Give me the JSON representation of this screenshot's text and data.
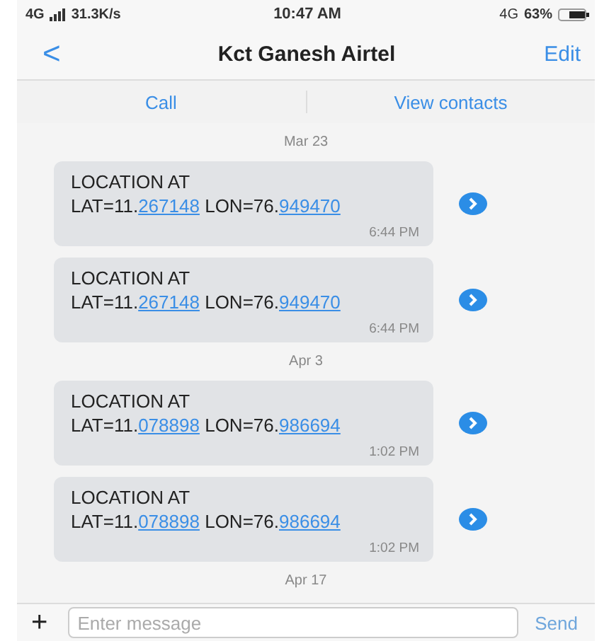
{
  "status_bar": {
    "network": "4G",
    "speed": "31.3K/s",
    "time": "10:47 AM",
    "network_right": "4G",
    "battery": "63%"
  },
  "header": {
    "back": "<",
    "title": "Kct Ganesh Airtel",
    "edit": "Edit"
  },
  "actions": [
    "Call",
    "View contacts"
  ],
  "thread": [
    {
      "kind": "date",
      "text": "Mar 23"
    },
    {
      "kind": "message",
      "heading": "LOCATION AT",
      "lat_prefix": "LAT=11.",
      "lat_link": "267148",
      "lon_prefix": "LON=76.",
      "lon_link": "949470",
      "time": "6:44 PM"
    },
    {
      "kind": "message",
      "heading": "LOCATION AT",
      "lat_prefix": "LAT=11.",
      "lat_link": "267148",
      "lon_prefix": "LON=76.",
      "lon_link": "949470",
      "time": "6:44 PM"
    },
    {
      "kind": "date",
      "text": "Apr 3"
    },
    {
      "kind": "message",
      "heading": "LOCATION AT",
      "lat_prefix": "LAT=11.",
      "lat_link": "078898",
      "lon_prefix": "LON=76.",
      "lon_link": "986694",
      "time": "1:02 PM"
    },
    {
      "kind": "message",
      "heading": "LOCATION AT",
      "lat_prefix": "LAT=11.",
      "lat_link": "078898",
      "lon_prefix": "LON=76.",
      "lon_link": "986694",
      "time": "1:02 PM"
    },
    {
      "kind": "date",
      "text": "Apr 17"
    }
  ],
  "composer": {
    "plus": "+",
    "placeholder": "Enter message",
    "send": "Send"
  }
}
